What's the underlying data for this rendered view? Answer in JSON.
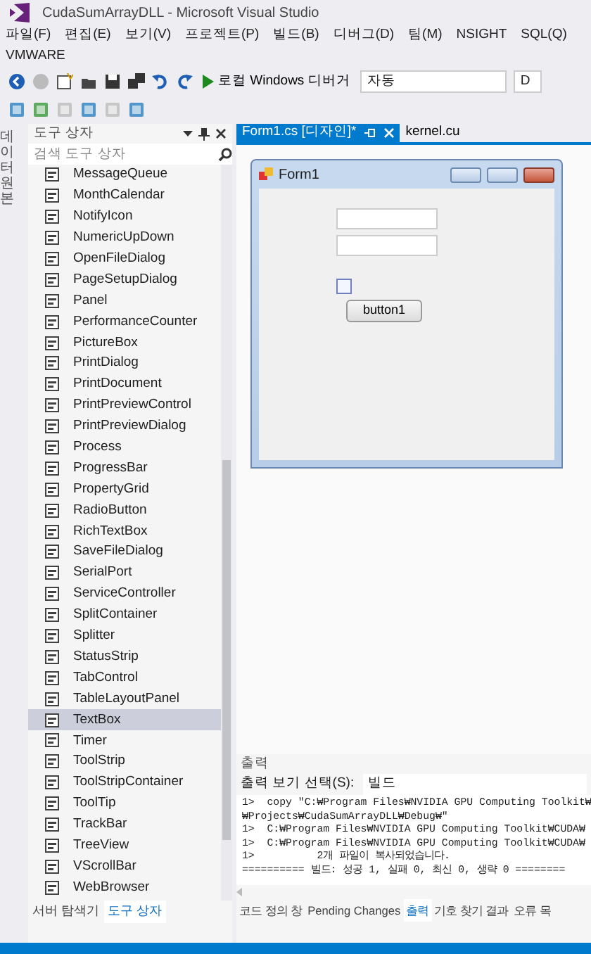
{
  "window": {
    "title": "CudaSumArrayDLL - Microsoft Visual Studio"
  },
  "menu": [
    "파일(F)",
    "편집(E)",
    "보기(V)",
    "프로젝트(P)",
    "빌드(B)",
    "디버그(D)",
    "팀(M)",
    "NSIGHT",
    "SQL(Q)",
    "VMWARE"
  ],
  "toolbar": {
    "debugger": "로컬 Windows 디버거",
    "config": "자동",
    "platform": "D"
  },
  "side_strip": {
    "label": "데이터 원본"
  },
  "toolbox": {
    "title": "도구 상자",
    "search": {
      "placeholder": "검색 도구 상자"
    },
    "items": [
      {
        "label": "MessageQueue",
        "selected": false
      },
      {
        "label": "MonthCalendar",
        "selected": false
      },
      {
        "label": "NotifyIcon",
        "selected": false
      },
      {
        "label": "NumericUpDown",
        "selected": false
      },
      {
        "label": "OpenFileDialog",
        "selected": false
      },
      {
        "label": "PageSetupDialog",
        "selected": false
      },
      {
        "label": "Panel",
        "selected": false
      },
      {
        "label": "PerformanceCounter",
        "selected": false
      },
      {
        "label": "PictureBox",
        "selected": false
      },
      {
        "label": "PrintDialog",
        "selected": false
      },
      {
        "label": "PrintDocument",
        "selected": false
      },
      {
        "label": "PrintPreviewControl",
        "selected": false
      },
      {
        "label": "PrintPreviewDialog",
        "selected": false
      },
      {
        "label": "Process",
        "selected": false
      },
      {
        "label": "ProgressBar",
        "selected": false
      },
      {
        "label": "PropertyGrid",
        "selected": false
      },
      {
        "label": "RadioButton",
        "selected": false
      },
      {
        "label": "RichTextBox",
        "selected": false
      },
      {
        "label": "SaveFileDialog",
        "selected": false
      },
      {
        "label": "SerialPort",
        "selected": false
      },
      {
        "label": "ServiceController",
        "selected": false
      },
      {
        "label": "SplitContainer",
        "selected": false
      },
      {
        "label": "Splitter",
        "selected": false
      },
      {
        "label": "StatusStrip",
        "selected": false
      },
      {
        "label": "TabControl",
        "selected": false
      },
      {
        "label": "TableLayoutPanel",
        "selected": false
      },
      {
        "label": "TextBox",
        "selected": true
      },
      {
        "label": "Timer",
        "selected": false
      },
      {
        "label": "ToolStrip",
        "selected": false
      },
      {
        "label": "ToolStripContainer",
        "selected": false
      },
      {
        "label": "ToolTip",
        "selected": false
      },
      {
        "label": "TrackBar",
        "selected": false
      },
      {
        "label": "TreeView",
        "selected": false
      },
      {
        "label": "VScrollBar",
        "selected": false
      },
      {
        "label": "WebBrowser",
        "selected": false
      }
    ],
    "tabs": [
      {
        "label": "서버 탐색기",
        "selected": false
      },
      {
        "label": "도구 상자",
        "selected": true
      }
    ]
  },
  "documents": {
    "tabs": [
      {
        "label": "Form1.cs [디자인]*",
        "selected": true
      },
      {
        "label": "kernel.cu",
        "selected": false
      }
    ]
  },
  "designer": {
    "form_title": "Form1",
    "button": "button1"
  },
  "output": {
    "title": "출력",
    "source_label": "출력 보기 선택(S):",
    "source": "빌드",
    "lines": [
      "1>  copy \"C:₩Program Files₩NVIDIA GPU Computing Toolkit₩",
      "₩Projects₩CudaSumArrayDLL₩Debug₩\"",
      "1>  C:₩Program Files₩NVIDIA GPU Computing Toolkit₩CUDA₩",
      "1>  C:₩Program Files₩NVIDIA GPU Computing Toolkit₩CUDA₩",
      "1>          2개 파일이 복사되었습니다.",
      "========== 빌드: 성공 1, 실패 0, 최신 0, 생략 0 ========"
    ],
    "tabs": [
      {
        "label": "코드 정의 창",
        "selected": false
      },
      {
        "label": "Pending Changes",
        "selected": false
      },
      {
        "label": "출력",
        "selected": true
      },
      {
        "label": "기호 찾기 결과",
        "selected": false
      },
      {
        "label": "오류 목",
        "selected": false
      }
    ]
  }
}
